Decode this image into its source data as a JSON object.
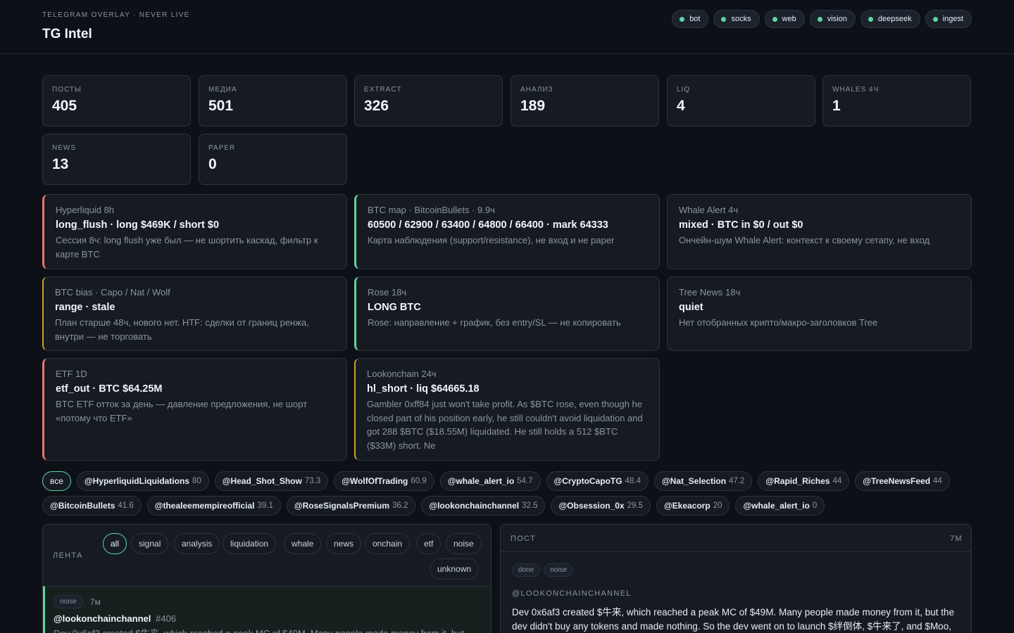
{
  "header": {
    "kicker": "TELEGRAM OVERLAY · NEVER LIVE",
    "title": "TG Intel",
    "services": [
      {
        "label": "bot",
        "status_color": "#5fd3a0"
      },
      {
        "label": "socks",
        "status_color": "#5fd3a0"
      },
      {
        "label": "web",
        "status_color": "#5fd3a0"
      },
      {
        "label": "vision",
        "status_color": "#5fd3a0"
      },
      {
        "label": "deepseek",
        "status_color": "#5fd3a0"
      },
      {
        "label": "ingest",
        "status_color": "#5fd3a0"
      }
    ]
  },
  "stats": [
    {
      "label": "ПОСТЫ",
      "value": "405"
    },
    {
      "label": "МЕДИА",
      "value": "501"
    },
    {
      "label": "EXTRACT",
      "value": "326"
    },
    {
      "label": "АНАЛИЗ",
      "value": "189"
    },
    {
      "label": "LIQ",
      "value": "4"
    },
    {
      "label": "WHALES 4Ч",
      "value": "1"
    },
    {
      "label": "NEWS",
      "value": "13"
    },
    {
      "label": "PAPER",
      "value": "0"
    }
  ],
  "cards": [
    {
      "source": "Hyperliquid 8h",
      "headline": "long_flush · long $469K / short $0",
      "body": "Сессия 8ч: long flush уже был — не шортить каскад, фильтр к карте BTC",
      "accent": "red"
    },
    {
      "source": "BTC map · BitcoinBullets · 9.9ч",
      "headline": "60500 / 62900 / 63400 / 64800 / 66400 · mark 64333",
      "body": "Карта наблюдения (support/resistance), не вход и не paper",
      "accent": "green"
    },
    {
      "source": "Whale Alert 4ч",
      "headline": "mixed · BTC in $0 / out $0",
      "body": "Ончейн-шум Whale Alert: контекст к своему сетапу, не вход",
      "accent": "none"
    },
    {
      "source": "BTC bias · Capo / Nat / Wolf",
      "headline": "range · stale",
      "body": "План старше 48ч, нового нет. HTF: сделки от границ ренжа, внутри — не торговать",
      "accent": "yellow"
    },
    {
      "source": "Rose 18ч",
      "headline": "LONG BTC",
      "body": "Rose: направление + график, без entry/SL — не копировать",
      "accent": "green"
    },
    {
      "source": "Tree News 18ч",
      "headline": "quiet",
      "body": "Нет отобранных крипто/макро-заголовков Tree",
      "accent": "none"
    },
    {
      "source": "ETF 1D",
      "headline": "etf_out · BTC $64.25M",
      "body": "BTC ETF отток за день — давление предложения, не шорт «потому что ETF»",
      "accent": "red"
    },
    {
      "source": "Lookonchain 24ч",
      "headline": "hl_short · liq $64665.18",
      "body": "Gambler 0xff84 just won't take profit. As $BTC rose, even though he closed part of his position early, he still couldn't avoid liquidation and got 288 $BTC ($18.55M) liquidated. He still holds a 512 $BTC ($33M) short. Ne",
      "accent": "yellow"
    }
  ],
  "channels_all_label": "все",
  "channels": [
    {
      "name": "@HyperliquidLiquidations",
      "score": "80"
    },
    {
      "name": "@Head_Shot_Show",
      "score": "73.3"
    },
    {
      "name": "@WolfOfTrading",
      "score": "60.9"
    },
    {
      "name": "@whale_alert_io",
      "score": "54.7"
    },
    {
      "name": "@CryptoCapoTG",
      "score": "48.4"
    },
    {
      "name": "@Nat_Selection",
      "score": "47.2"
    },
    {
      "name": "@Rapid_Riches",
      "score": "44"
    },
    {
      "name": "@TreeNewsFeed",
      "score": "44"
    },
    {
      "name": "@BitcoinBullets",
      "score": "41.6"
    },
    {
      "name": "@thealeemempireofficial",
      "score": "39.1"
    },
    {
      "name": "@RoseSignalsPremium",
      "score": "36.2"
    },
    {
      "name": "@lookonchainchannel",
      "score": "32.5"
    },
    {
      "name": "@Obsession_0x",
      "score": "29.5"
    },
    {
      "name": "@Ekeacorp",
      "score": "20"
    },
    {
      "name": "@whale_alert_io",
      "score": "0"
    }
  ],
  "feed": {
    "title": "ЛЕНТА",
    "filters": [
      "all",
      "signal",
      "analysis",
      "liquidation",
      "whale",
      "news",
      "onchain",
      "etf",
      "noise",
      "unknown"
    ],
    "active_filter": "all",
    "items": [
      {
        "tag": "noise",
        "age": "7м",
        "channel": "@lookonchainchannel",
        "post_id": "#406",
        "preview": "Dev 0x6af3 created $牛来, which reached a peak MC of $49M. Many people made money from it, but"
      }
    ]
  },
  "post": {
    "title": "ПОСТ",
    "age": "7М",
    "tags": [
      "done",
      "noise"
    ],
    "channel": "@LOOKONCHAINCHANNEL",
    "text": "Dev 0x6af3 created $牛来, which reached a peak MC of $49M. Many people made money from it, but the dev didn't buy any tokens and made nothing. So the dev went on to launch $绊倒体, $牛来了, and $Moo,"
  }
}
